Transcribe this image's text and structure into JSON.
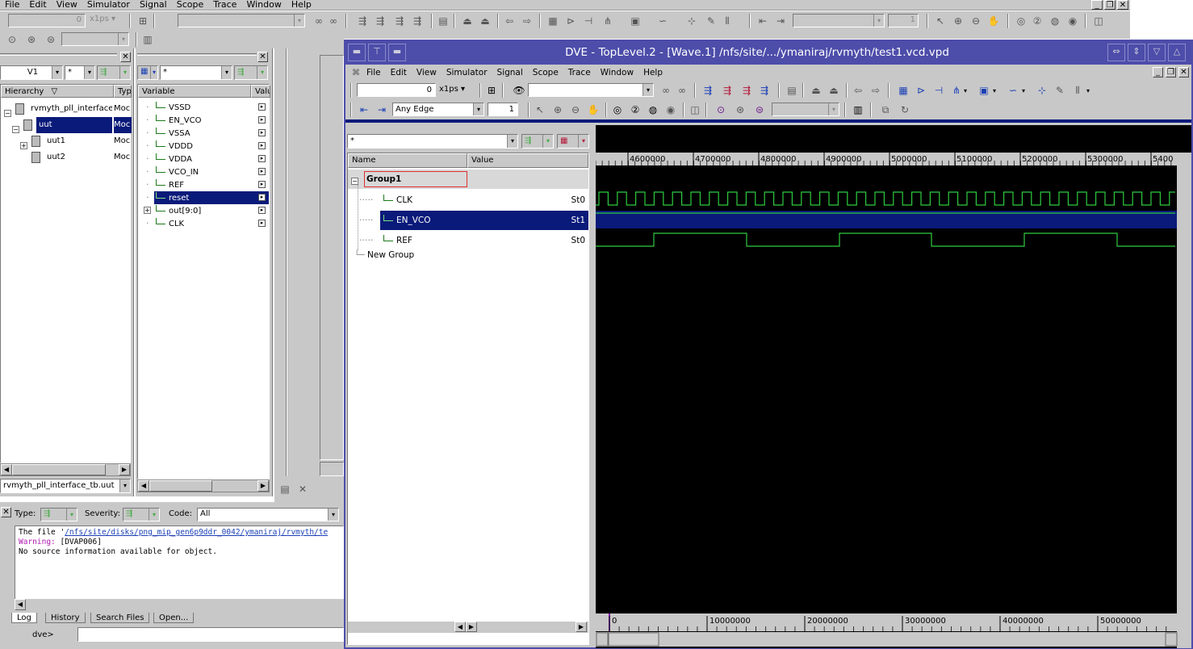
{
  "bg_app": {
    "menu": [
      "File",
      "Edit",
      "View",
      "Simulator",
      "Signal",
      "Scope",
      "Trace",
      "Window",
      "Help"
    ],
    "time_value": "0",
    "time_unit": "x1ps",
    "step_value": "1"
  },
  "hierarchy": {
    "scope_combo_value": "V1",
    "filter_value": "*",
    "col_hierarchy": "Hierarchy",
    "col_type": "Type",
    "items": [
      {
        "label": "rvmyth_pll_interface...",
        "type": "Moc",
        "indent": 0,
        "expander": "-",
        "selected": false
      },
      {
        "label": "uut",
        "type": "Moc",
        "indent": 1,
        "expander": "-",
        "selected": true
      },
      {
        "label": "uut1",
        "type": "Moc",
        "indent": 2,
        "expander": "+",
        "selected": false
      },
      {
        "label": "uut2",
        "type": "Moc",
        "indent": 2,
        "expander": "",
        "selected": false
      }
    ],
    "path_value": "rvmyth_pll_interface_tb.uut"
  },
  "variables": {
    "filter_value": "*",
    "col_variable": "Variable",
    "col_value": "Valu",
    "items": [
      {
        "label": "VSSD",
        "expander": "",
        "selected": false
      },
      {
        "label": "EN_VCO",
        "expander": "",
        "selected": false
      },
      {
        "label": "VSSA",
        "expander": "",
        "selected": false
      },
      {
        "label": "VDDD",
        "expander": "",
        "selected": false
      },
      {
        "label": "VDDA",
        "expander": "",
        "selected": false
      },
      {
        "label": "VCO_IN",
        "expander": "",
        "selected": false
      },
      {
        "label": "REF",
        "expander": "",
        "selected": false
      },
      {
        "label": "reset",
        "expander": "",
        "selected": true
      },
      {
        "label": "out[9:0]",
        "expander": "+",
        "selected": false
      },
      {
        "label": "CLK",
        "expander": "",
        "selected": false
      }
    ]
  },
  "console": {
    "type_label": "Type:",
    "severity_label": "Severity:",
    "code_label": "Code:",
    "code_value": "All",
    "lines": [
      {
        "prefix": "The file '",
        "link": "/nfs/site/disks/png_mip_gen6p9ddr_0042/ymaniraj/rvmyth/te",
        "suffix": ""
      },
      {
        "prefix": "",
        "warn": "Warning:",
        "suffix": " [DVAP006]"
      },
      {
        "prefix": "No source information available for object.",
        "suffix": ""
      }
    ],
    "tabs": [
      "Log",
      "History",
      "Search Files",
      "Open..."
    ],
    "prompt": "dve>",
    "command_value": ""
  },
  "wave_window": {
    "title": "DVE - TopLevel.2 - [Wave.1]  /nfs/site/.../ymaniraj/rvmyth/test1.vcd.vpd",
    "menu": [
      "File",
      "Edit",
      "View",
      "Simulator",
      "Signal",
      "Scope",
      "Trace",
      "Window",
      "Help"
    ],
    "time_value": "0",
    "time_unit": "x1ps",
    "edge_value": "Any Edge",
    "step_value": "1",
    "signal_filter_value": "*",
    "col_name": "Name",
    "col_value": "Value",
    "group_name": "Group1",
    "new_group_label": "New Group",
    "signals": [
      {
        "name": "CLK",
        "value": "St0",
        "selected": false
      },
      {
        "name": "EN_VCO",
        "value": "St1",
        "selected": true
      },
      {
        "name": "REF",
        "value": "St0",
        "selected": false
      }
    ],
    "ruler_top": [
      "4600000",
      "4700000",
      "4800000",
      "4900000",
      "5000000",
      "5100000",
      "5200000",
      "5300000",
      "5400"
    ],
    "ruler_bottom": [
      "0",
      "10000000",
      "20000000",
      "30000000",
      "40000000",
      "50000000"
    ],
    "colors": {
      "waveform": "#2ecc40",
      "selection": "#0a1a7a",
      "title_bar": "#4d4daa",
      "group_highlight": "#e03030"
    }
  }
}
